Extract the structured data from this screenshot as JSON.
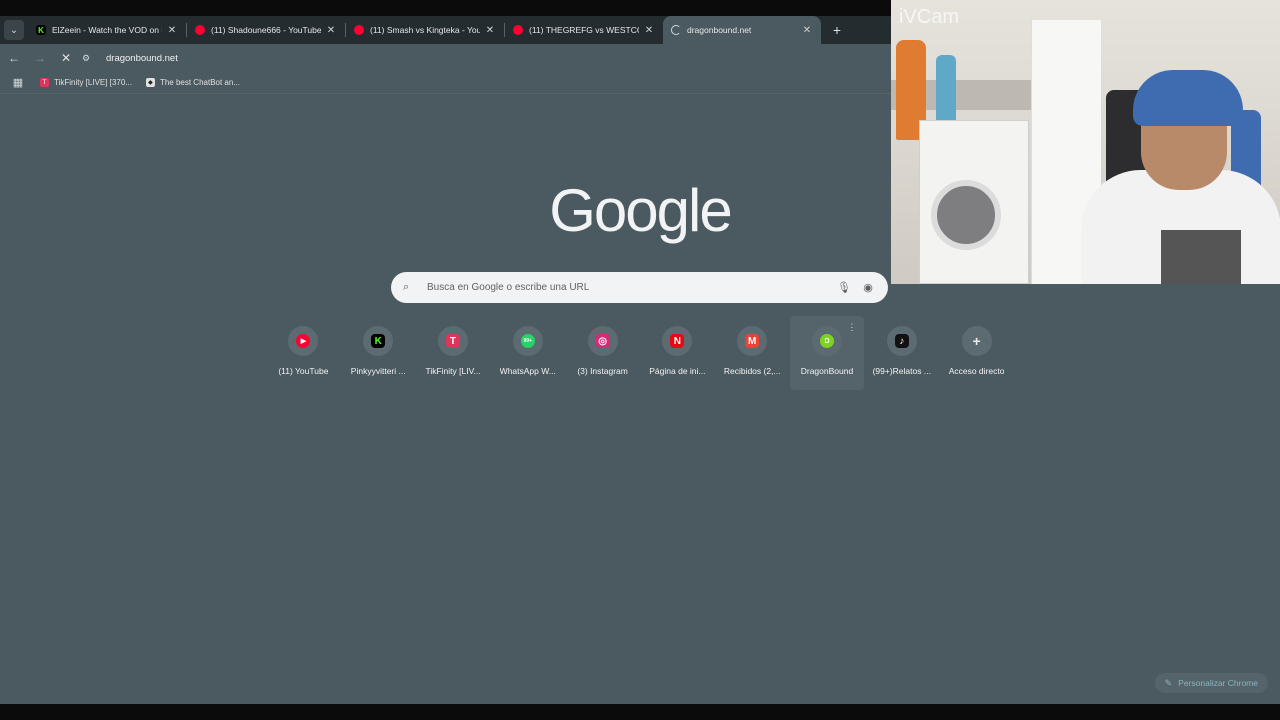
{
  "tabs": [
    {
      "title": "ElZeein - Watch the VOD on Ki",
      "favicon": "kick-icon",
      "color": "#53fc18"
    },
    {
      "title": "(11) Shadoune666 - YouTube",
      "favicon": "youtube-icon",
      "color": "#ff0033"
    },
    {
      "title": "(11) Smash vs Kingteka - YouTu",
      "favicon": "youtube-icon",
      "color": "#ff0033"
    },
    {
      "title": "(11) THEGREFG vs WESTCOL | L",
      "favicon": "youtube-icon",
      "color": "#ff0033"
    },
    {
      "title": "dragonbound.net",
      "favicon": "loading-icon",
      "color": "#cfd8dc"
    }
  ],
  "toolbar": {
    "url": "dragonbound.net"
  },
  "bookmarks": [
    {
      "label": "TikFinity [LIVE] [370...",
      "color": "#e0345a"
    },
    {
      "label": "The best ChatBot an...",
      "color": "#e0e0e0"
    }
  ],
  "logo": "Google",
  "search": {
    "placeholder": "Busca en Google o escribe una URL"
  },
  "shortcuts": [
    {
      "label": "(11) YouTube",
      "icon": "youtube-icon",
      "color": "#ff0033",
      "glyph": "▶"
    },
    {
      "label": "Pinkyyvitteri ...",
      "icon": "kick-icon",
      "color": "#53fc18",
      "glyph": "K"
    },
    {
      "label": "TikFinity [LIV...",
      "icon": "tikfinity-icon",
      "color": "#e0345a",
      "glyph": "T"
    },
    {
      "label": "WhatsApp W...",
      "icon": "whatsapp-icon",
      "color": "#25d366",
      "glyph": "99+"
    },
    {
      "label": "(3) Instagram",
      "icon": "instagram-icon",
      "color": "#d62976",
      "glyph": "◎"
    },
    {
      "label": "Página de ini...",
      "icon": "netflix-icon",
      "color": "#e50914",
      "glyph": "N"
    },
    {
      "label": "Recibidos (2,...",
      "icon": "gmail-icon",
      "color": "#ea4335",
      "glyph": "M"
    },
    {
      "label": "DragonBound",
      "icon": "dragonbound-icon",
      "color": "#7ed321",
      "glyph": "D"
    },
    {
      "label": "(99+)Relatos ...",
      "icon": "tiktok-icon",
      "color": "#111111",
      "glyph": "♪"
    },
    {
      "label": "Acceso directo",
      "icon": "plus-icon",
      "color": "#5c6b71",
      "glyph": "+"
    }
  ],
  "customize": {
    "label": "Personalizar Chrome"
  },
  "webcam": {
    "watermark": "iVCam"
  }
}
